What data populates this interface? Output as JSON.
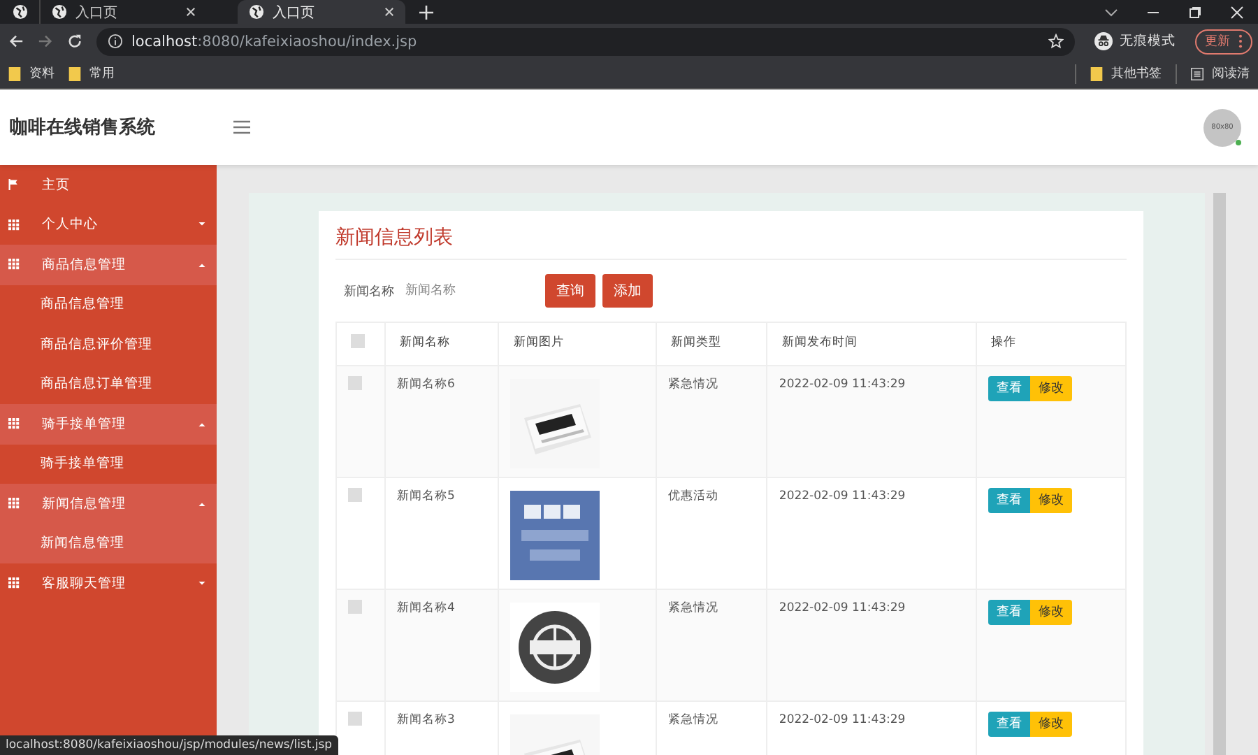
{
  "browser": {
    "tabs": [
      {
        "title": "入口页",
        "selected": false
      },
      {
        "title": "入口页",
        "selected": true
      }
    ],
    "address": {
      "host": "localhost",
      "path": ":8080/kafeixiaoshou/index.jsp"
    },
    "incognito": "无痕模式",
    "update_button": "更新",
    "bookmarks_left": [
      "资料",
      "常用"
    ],
    "bookmarks_right": [
      {
        "label": "其他书签",
        "kind": "folder"
      },
      {
        "label": "阅读清",
        "kind": "list"
      }
    ],
    "status_url": "localhost:8080/kafeixiaoshou/jsp/modules/news/list.jsp"
  },
  "app": {
    "title": "咖啡在线销售系统",
    "avatar": "80x80"
  },
  "sidebar": {
    "items": [
      {
        "kind": "home",
        "label": "主页"
      },
      {
        "kind": "group",
        "label": "个人中心",
        "expanded": false
      },
      {
        "kind": "group",
        "label": "商品信息管理",
        "expanded": true,
        "children": [
          {
            "label": "商品信息管理",
            "selected": false
          },
          {
            "label": "商品信息评价管理",
            "selected": false
          },
          {
            "label": "商品信息订单管理",
            "selected": false
          }
        ]
      },
      {
        "kind": "group",
        "label": "骑手接单管理",
        "expanded": true,
        "children": [
          {
            "label": "骑手接单管理",
            "selected": false
          }
        ]
      },
      {
        "kind": "group",
        "label": "新闻信息管理",
        "expanded": true,
        "children": [
          {
            "label": "新闻信息管理",
            "selected": true
          }
        ]
      },
      {
        "kind": "group",
        "label": "客服聊天管理",
        "expanded": false
      }
    ]
  },
  "panel": {
    "title": "新闻信息列表",
    "search": {
      "label": "新闻名称",
      "placeholder": "新闻名称"
    },
    "buttons": [
      "查询",
      "添加"
    ],
    "table": {
      "columns": [
        "新闻名称",
        "新闻图片",
        "新闻类型",
        "新闻发布时间",
        "操作"
      ],
      "header_checked": false,
      "rows": [
        {
          "checked": false,
          "name": "新闻名称6",
          "type": "紧急情况",
          "time": "2022-02-09 11:43:29",
          "actions": [
            "查看",
            "修改"
          ]
        },
        {
          "checked": false,
          "name": "新闻名称5",
          "type": "优惠活动",
          "time": "2022-02-09 11:43:29",
          "actions": [
            "查看",
            "修改"
          ]
        },
        {
          "checked": false,
          "name": "新闻名称4",
          "type": "紧急情况",
          "time": "2022-02-09 11:43:29",
          "actions": [
            "查看",
            "修改"
          ]
        },
        {
          "checked": false,
          "name": "新闻名称3",
          "type": "紧急情况",
          "time": "2022-02-09 11:43:29",
          "actions": [
            "查看",
            "修改"
          ]
        }
      ]
    }
  }
}
